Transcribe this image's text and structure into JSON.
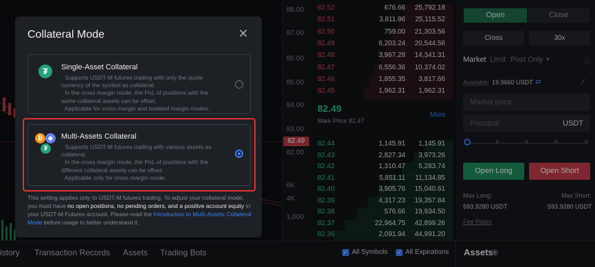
{
  "chart_axis": {
    "ticks": [
      "88.00",
      "87.00",
      "86.00",
      "85.00",
      "84.00",
      "83.00",
      "82.00",
      "6K",
      "4K",
      "1,000"
    ],
    "current": "82.49"
  },
  "order_book": {
    "asks": [
      [
        "82.52",
        "676.66",
        "25,792.18"
      ],
      [
        "82.51",
        "3,811.96",
        "25,115.52"
      ],
      [
        "82.50",
        "759.00",
        "21,303.56"
      ],
      [
        "82.49",
        "6,203.24",
        "20,544.56"
      ],
      [
        "82.48",
        "3,967.28",
        "14,341.31"
      ],
      [
        "82.47",
        "6,556.36",
        "10,374.02"
      ],
      [
        "82.46",
        "1,855.35",
        "3,817.66"
      ],
      [
        "82.45",
        "1,962.31",
        "1,962.31"
      ]
    ],
    "mid_price": "82.49",
    "mark_price": "Mark Price 82.47",
    "more": "More",
    "bids": [
      [
        "82.44",
        "1,145.91",
        "1,145.91"
      ],
      [
        "82.43",
        "2,827.34",
        "3,973.26"
      ],
      [
        "82.42",
        "1,310.47",
        "5,283.74"
      ],
      [
        "82.41",
        "5,851.11",
        "11,134.85"
      ],
      [
        "82.40",
        "3,905.76",
        "15,040.61"
      ],
      [
        "82.39",
        "4,317.23",
        "19,357.84"
      ],
      [
        "82.38",
        "576.66",
        "19,934.50"
      ],
      [
        "82.37",
        "22,964.75",
        "42,899.26"
      ],
      [
        "82.36",
        "2,091.94",
        "44,991.20"
      ]
    ]
  },
  "trade_panel": {
    "tab_open": "Open",
    "tab_close": "Close",
    "margin_mode": "Cross",
    "leverage": "30x",
    "order_types": [
      "Market",
      "Limit",
      "Post Only"
    ],
    "available_label": "Available:",
    "available_value": "19.9660 USDT",
    "market_price_placeholder": "Market price",
    "principal_placeholder": "Principal",
    "principal_unit": "USDT",
    "open_long": "Open Long",
    "open_short": "Open Short",
    "max_long_label": "Max Long:",
    "max_short_label": "Max Short:",
    "max_long_value": "593.9280 USDT",
    "max_short_value": "593.9280 USDT",
    "fee_rates": "Fee Rates"
  },
  "bottom_bar": {
    "tabs": [
      "istory",
      "Transaction Records",
      "Assets",
      "Trading Bots"
    ],
    "all_symbols": "All Symbols",
    "all_expirations": "All Expirations",
    "assets": "Assets"
  },
  "modal": {
    "title": "Collateral Mode",
    "options": [
      {
        "title": "Single-Asset Collateral",
        "lines": [
          "· Supports USDT-M futures trading with only the quote currency of the symbol as collateral.",
          "· In the cross margin mode, the PnL of positions with the same collateral assets can be offset.",
          "· Applicable for cross margin and isolated margin modes."
        ],
        "selected": false
      },
      {
        "title": "Multi-Assets Collateral",
        "lines": [
          "· Supports USDT-M futures trading with various assets as collateral.",
          "· In the cross margin mode, the PnL of positions with the different collateral assets can be offset.",
          "· Applicable only for cross margin mode."
        ],
        "selected": true
      }
    ],
    "note_part1": "This setting applies only to USDT-M futures trading. To adjust your collateral mode, you must have ",
    "note_bold": "no open positions, no pending orders, and a positive account equity",
    "note_part2": " in your USDT-M Futures account. Please read the ",
    "note_link": "Introduction to Multi-Assets Collateral Mode",
    "note_part3": " before usage to better understand it."
  },
  "colors": {
    "accent": "#3b82f6",
    "buy": "#2ebd85",
    "sell": "#d9485a",
    "highlight": "#e2332f"
  }
}
